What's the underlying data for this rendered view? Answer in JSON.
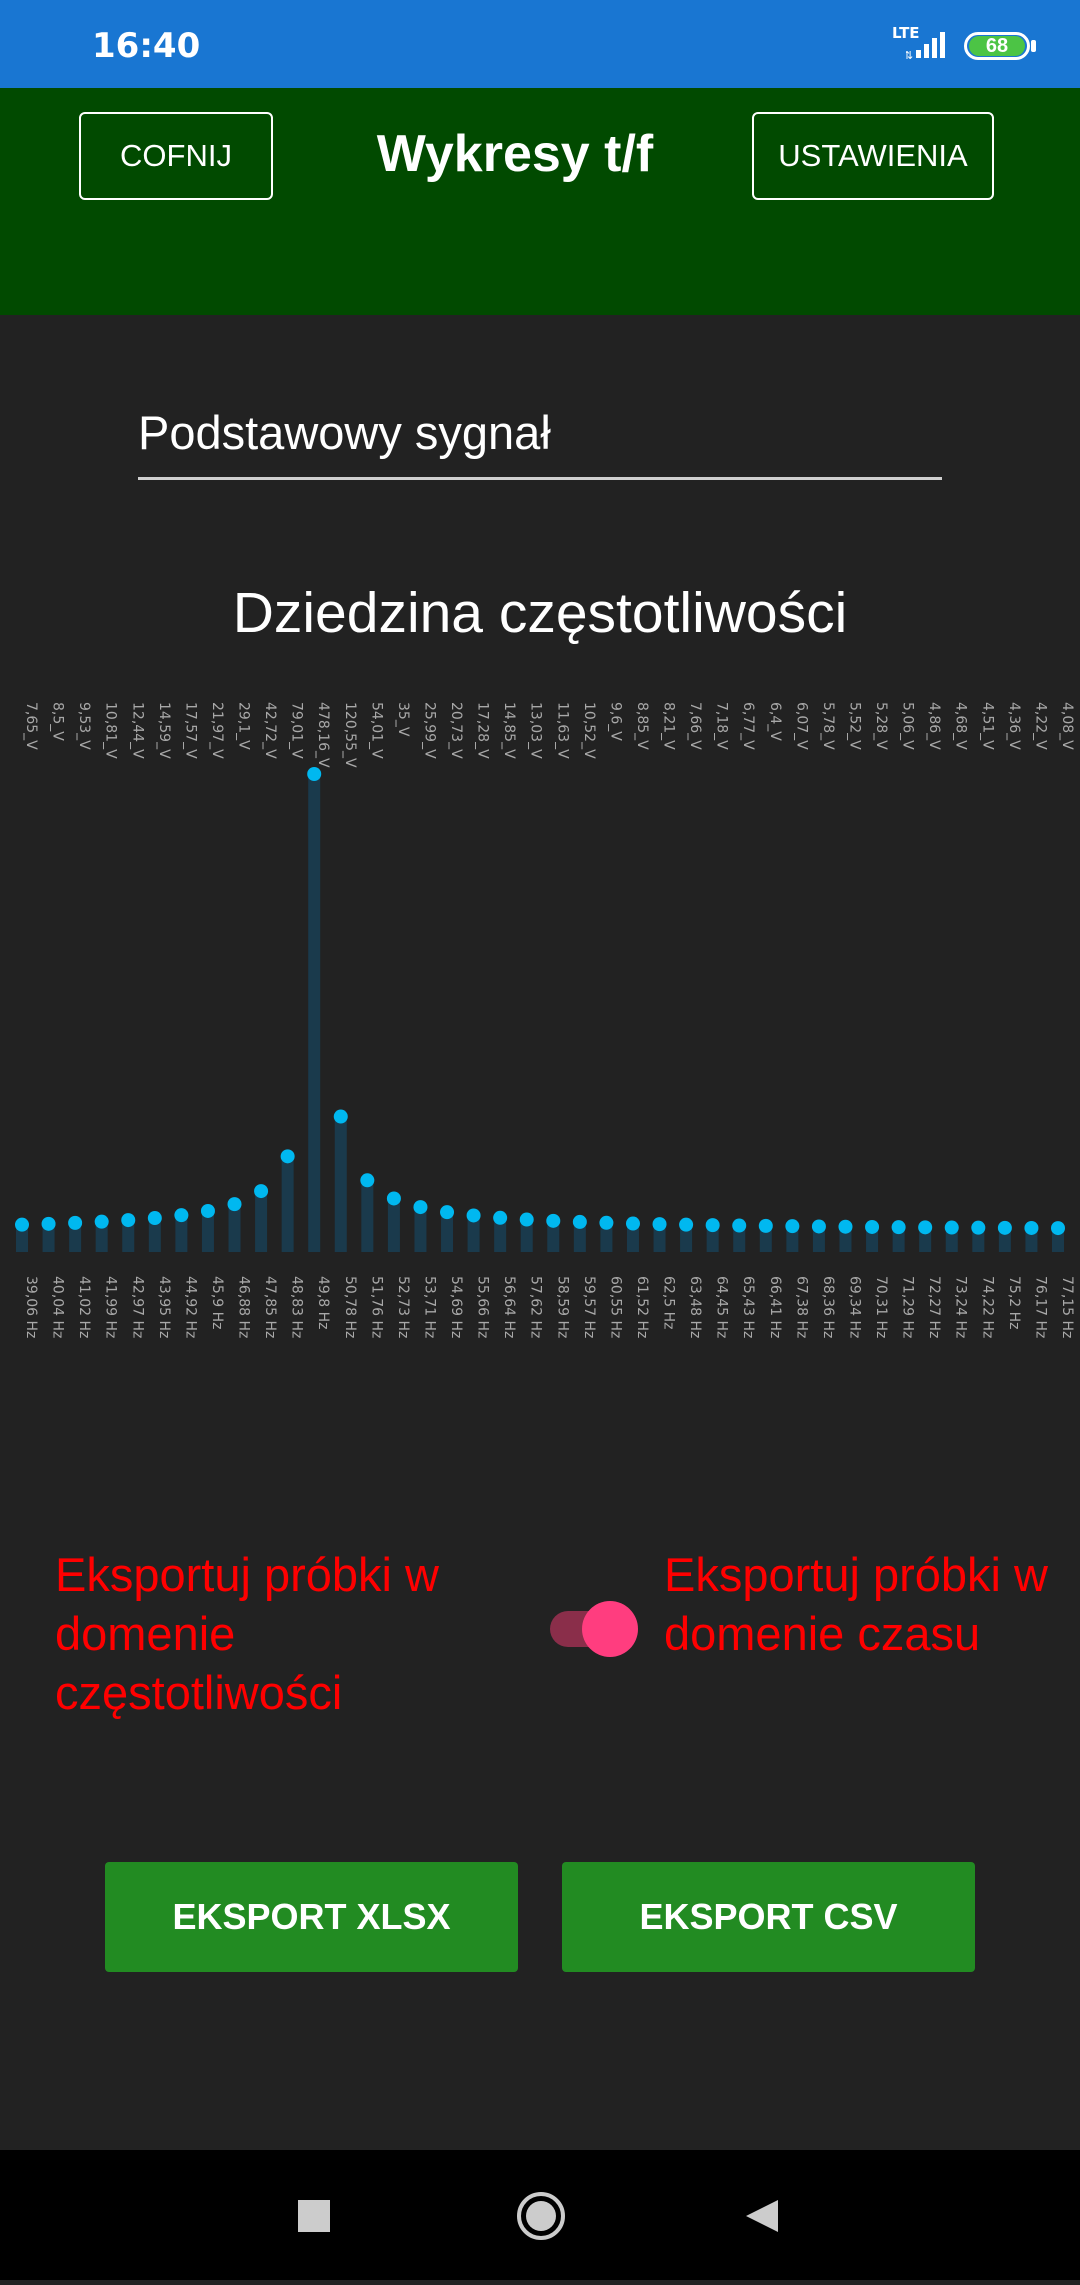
{
  "status_bar": {
    "time": "16:40",
    "network": "LTE",
    "battery": "68",
    "icons": [
      "signal-icon",
      "battery-icon"
    ]
  },
  "header": {
    "back_label": "COFNIJ",
    "title": "Wykresy t/f",
    "settings_label": "USTAWIENIA"
  },
  "signal_select": {
    "value": "Podstawowy sygnał"
  },
  "chart_title": "Dziedzina częstotliwości",
  "chart_data": {
    "type": "scatter",
    "categories": [
      "39,06 Hz",
      "40,04 Hz",
      "41,02 Hz",
      "41,99 Hz",
      "42,97 Hz",
      "43,95 Hz",
      "44,92 Hz",
      "45,9 Hz",
      "46,88 Hz",
      "47,85 Hz",
      "48,83 Hz",
      "49,8 Hz",
      "50,78 Hz",
      "51,76 Hz",
      "52,73 Hz",
      "53,71 Hz",
      "54,69 Hz",
      "55,66 Hz",
      "56,64 Hz",
      "57,62 Hz",
      "58,59 Hz",
      "59,57 Hz",
      "60,55 Hz",
      "61,52 Hz",
      "62,5 Hz",
      "63,48 Hz",
      "64,45 Hz",
      "65,43 Hz",
      "66,41 Hz",
      "67,38 Hz",
      "68,36 Hz",
      "69,34 Hz",
      "70,31 Hz",
      "71,29 Hz",
      "72,27 Hz",
      "73,24 Hz",
      "74,22 Hz",
      "75,2 Hz",
      "76,17 Hz",
      "77,15 Hz"
    ],
    "value_labels": [
      "7,65_V",
      "8,5_V",
      "9,53_V",
      "10,81_V",
      "12,44_V",
      "14,59_V",
      "17,57_V",
      "21,97_V",
      "29,1_V",
      "42,72_V",
      "79,01_V",
      "478,16_V",
      "120,55_V",
      "54,01_V",
      "35_V",
      "25,99_V",
      "20,73_V",
      "17,28_V",
      "14,85_V",
      "13,03_V",
      "11,63_V",
      "10,52_V",
      "9,6_V",
      "8,85_V",
      "8,21_V",
      "7,66_V",
      "7,18_V",
      "6,77_V",
      "6,4_V",
      "6,07_V",
      "5,78_V",
      "5,52_V",
      "5,28_V",
      "5,06_V",
      "4,86_V",
      "4,68_V",
      "4,51_V",
      "4,36_V",
      "4,22_V",
      "4,08_V"
    ],
    "values": [
      7.65,
      8.5,
      9.53,
      10.81,
      12.44,
      14.59,
      17.57,
      21.97,
      29.1,
      42.72,
      79.01,
      478.16,
      120.55,
      54.01,
      35,
      25.99,
      20.73,
      17.28,
      14.85,
      13.03,
      11.63,
      10.52,
      9.6,
      8.85,
      8.21,
      7.66,
      7.18,
      6.77,
      6.4,
      6.07,
      5.78,
      5.52,
      5.28,
      5.06,
      4.86,
      4.68,
      4.51,
      4.36,
      4.22,
      4.08
    ],
    "ylim": [
      0,
      478.16
    ],
    "point_color": "#00B8F0",
    "stem_color": "#1A3A4C",
    "label_color": "#A8A8A8"
  },
  "export": {
    "freq_label": "Eksportuj próbki w domenie częstotliwości",
    "time_label": "Eksportuj próbki w domenie czasu",
    "toggle_on": true,
    "xlsx_label": "EKSPORT XLSX",
    "csv_label": "EKSPORT CSV"
  },
  "nav": {
    "icons": [
      "recents-square-icon",
      "home-circle-icon",
      "back-triangle-icon"
    ]
  }
}
